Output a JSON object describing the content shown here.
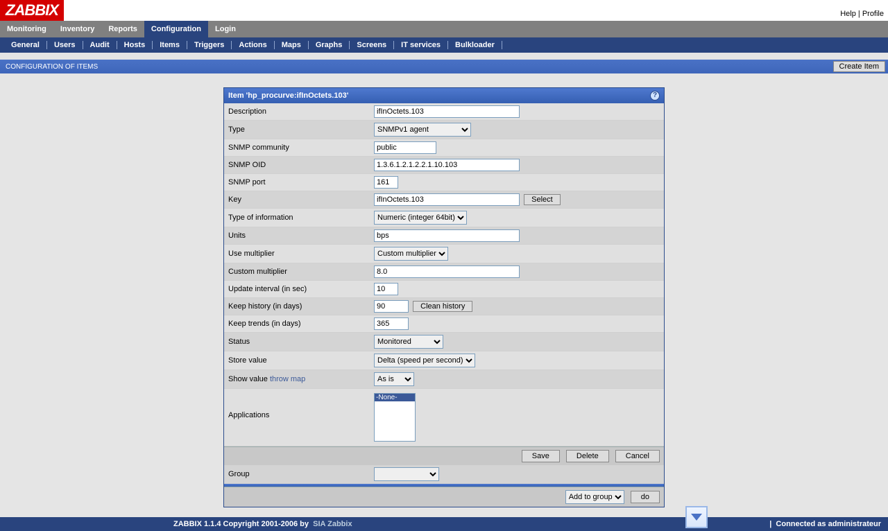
{
  "logo": "ZABBIX",
  "toplinks": {
    "help": "Help",
    "profile": "Profile"
  },
  "nav": [
    "Monitoring",
    "Inventory",
    "Reports",
    "Configuration",
    "Login"
  ],
  "nav_active": 3,
  "subnav": [
    "General",
    "Users",
    "Audit",
    "Hosts",
    "Items",
    "Triggers",
    "Actions",
    "Maps",
    "Graphs",
    "Screens",
    "IT services",
    "Bulkloader"
  ],
  "pagehead": {
    "title": "CONFIGURATION OF ITEMS",
    "create": "Create Item"
  },
  "panel_title": "Item 'hp_procurve:ifInOctets.103'",
  "labels": {
    "description": "Description",
    "type": "Type",
    "snmp_community": "SNMP community",
    "snmp_oid": "SNMP OID",
    "snmp_port": "SNMP port",
    "key": "Key",
    "select": "Select",
    "type_info": "Type of information",
    "units": "Units",
    "use_mult": "Use multiplier",
    "custom_mult": "Custom multiplier",
    "update": "Update interval (in sec)",
    "history": "Keep history (in days)",
    "clean": "Clean history",
    "trends": "Keep trends (in days)",
    "status": "Status",
    "store": "Store value",
    "showval": "Show value",
    "throwmap": "throw map",
    "apps": "Applications",
    "group": "Group",
    "addgroup": "Add to group",
    "do": "do"
  },
  "values": {
    "description": "ifInOctets.103",
    "type": "SNMPv1 agent",
    "community": "public",
    "oid": "1.3.6.1.2.1.2.2.1.10.103",
    "port": "161",
    "key": "ifInOctets.103",
    "type_info": "Numeric (integer 64bit)",
    "units": "bps",
    "use_mult": "Custom multiplier",
    "custom_mult": "8.0",
    "update": "10",
    "history": "90",
    "trends": "365",
    "status": "Monitored",
    "store": "Delta (speed per second)",
    "showval": "As is",
    "app_none": "-None-",
    "group_sel": "",
    "addgroup_sel": "Add to group"
  },
  "buttons": {
    "save": "Save",
    "delete": "Delete",
    "cancel": "Cancel"
  },
  "footer": {
    "copyright": "ZABBIX 1.1.4 Copyright 2001-2006 by",
    "sia": "SIA Zabbix",
    "conn": "Connected as administrateur"
  }
}
